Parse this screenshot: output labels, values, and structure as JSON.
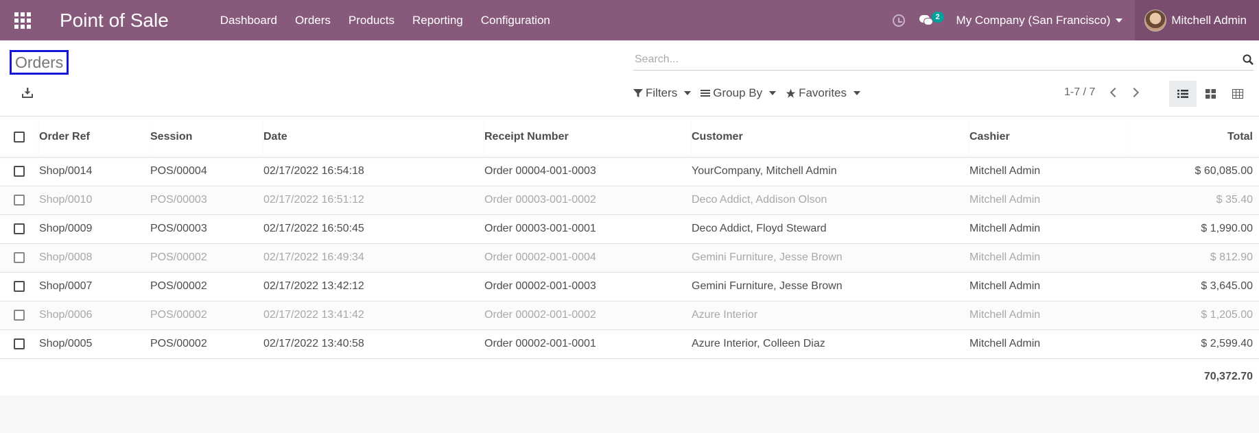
{
  "navbar": {
    "app_title": "Point of Sale",
    "menu": [
      "Dashboard",
      "Orders",
      "Products",
      "Reporting",
      "Configuration"
    ],
    "message_count": "2",
    "company": "My Company (San Francisco)",
    "user": "Mitchell Admin"
  },
  "control": {
    "title": "Orders",
    "search_placeholder": "Search...",
    "filters_label": "Filters",
    "groupby_label": "Group By",
    "favorites_label": "Favorites",
    "pager": "1-7 / 7"
  },
  "table": {
    "columns": [
      "Order Ref",
      "Session",
      "Date",
      "Receipt Number",
      "Customer",
      "Cashier",
      "Total"
    ],
    "rows": [
      {
        "ref": "Shop/0014",
        "session": "POS/00004",
        "date": "02/17/2022 16:54:18",
        "receipt": "Order 00004-001-0003",
        "customer": "YourCompany, Mitchell Admin",
        "cashier": "Mitchell Admin",
        "total": "$ 60,085.00",
        "muted": false
      },
      {
        "ref": "Shop/0010",
        "session": "POS/00003",
        "date": "02/17/2022 16:51:12",
        "receipt": "Order 00003-001-0002",
        "customer": "Deco Addict, Addison Olson",
        "cashier": "Mitchell Admin",
        "total": "$ 35.40",
        "muted": true
      },
      {
        "ref": "Shop/0009",
        "session": "POS/00003",
        "date": "02/17/2022 16:50:45",
        "receipt": "Order 00003-001-0001",
        "customer": "Deco Addict, Floyd Steward",
        "cashier": "Mitchell Admin",
        "total": "$ 1,990.00",
        "muted": false
      },
      {
        "ref": "Shop/0008",
        "session": "POS/00002",
        "date": "02/17/2022 16:49:34",
        "receipt": "Order 00002-001-0004",
        "customer": "Gemini Furniture, Jesse Brown",
        "cashier": "Mitchell Admin",
        "total": "$ 812.90",
        "muted": true
      },
      {
        "ref": "Shop/0007",
        "session": "POS/00002",
        "date": "02/17/2022 13:42:12",
        "receipt": "Order 00002-001-0003",
        "customer": "Gemini Furniture, Jesse Brown",
        "cashier": "Mitchell Admin",
        "total": "$ 3,645.00",
        "muted": false
      },
      {
        "ref": "Shop/0006",
        "session": "POS/00002",
        "date": "02/17/2022 13:41:42",
        "receipt": "Order 00002-001-0002",
        "customer": "Azure Interior",
        "cashier": "Mitchell Admin",
        "total": "$ 1,205.00",
        "muted": true
      },
      {
        "ref": "Shop/0005",
        "session": "POS/00002",
        "date": "02/17/2022 13:40:58",
        "receipt": "Order 00002-001-0001",
        "customer": "Azure Interior, Colleen Diaz",
        "cashier": "Mitchell Admin",
        "total": "$ 2,599.40",
        "muted": false
      }
    ],
    "grand_total": "70,372.70"
  },
  "colors": {
    "navbar": "#875a7b",
    "title_highlight": "#1515d8",
    "badge": "#00a09d"
  },
  "icons": [
    "apps-grid-icon",
    "clock-icon",
    "chat-icon",
    "download-icon",
    "search-icon",
    "filter-icon",
    "list-icon",
    "star-icon",
    "list-view-icon",
    "kanban-view-icon",
    "pivot-view-icon"
  ]
}
